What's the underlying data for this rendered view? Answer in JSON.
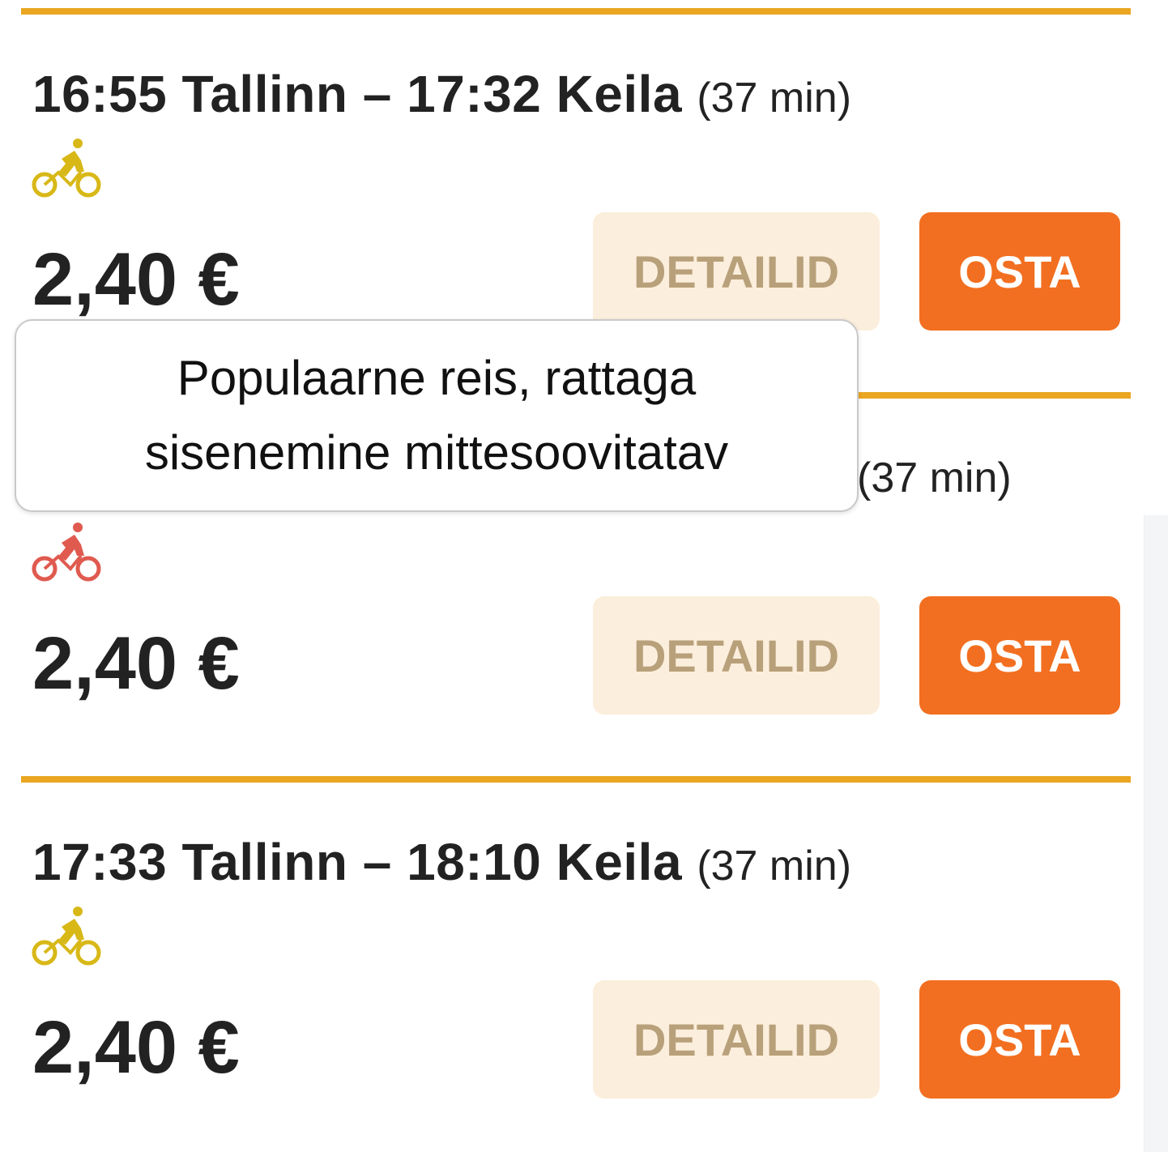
{
  "colors": {
    "rule": "#eaa621",
    "bike_ok": "#d8b817",
    "bike_warn": "#e05a4f",
    "details_bg": "#fbeedc",
    "details_text": "#b8a07a",
    "buy_bg": "#f26f21",
    "buy_text": "#ffffff"
  },
  "trips": [
    {
      "title": "16:55 Tallinn – 17:32 Keila",
      "duration": "(37 min)",
      "bike_icon": "bicycle-icon",
      "bike_status": "ok",
      "price": "2,40 €",
      "details_label": "DETAILID",
      "buy_label": "OSTA"
    },
    {
      "title": "",
      "duration": "(37 min)",
      "bike_icon": "bicycle-icon",
      "bike_status": "warning",
      "price": "2,40 €",
      "details_label": "DETAILID",
      "buy_label": "OSTA"
    },
    {
      "title": "17:33 Tallinn – 18:10 Keila",
      "duration": "(37 min)",
      "bike_icon": "bicycle-icon",
      "bike_status": "ok",
      "price": "2,40 €",
      "details_label": "DETAILID",
      "buy_label": "OSTA"
    }
  ],
  "tooltip": {
    "line1": "Populaarne reis, rattaga",
    "line2": "sisenemine mittesoovitatav"
  }
}
